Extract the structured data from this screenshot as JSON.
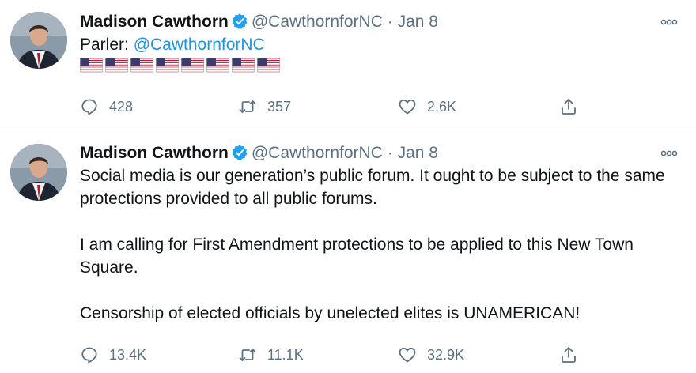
{
  "tweets": [
    {
      "author_name": "Madison Cawthorn",
      "handle": "@CawthornforNC",
      "separator": "·",
      "date": "Jan 8",
      "text_prefix": "Parler: ",
      "text_link": "@CawthornforNC",
      "flag_count_emoji": "🇺🇸🇺🇸🇺🇸🇺🇸🇺🇸🇺🇸🇺🇸🇺🇸",
      "replies": "428",
      "retweets": "357",
      "likes": "2.6K"
    },
    {
      "author_name": "Madison Cawthorn",
      "handle": "@CawthornforNC",
      "separator": "·",
      "date": "Jan 8",
      "paragraphs": [
        "Social media is our generation’s public forum. It ought to be subject to the same protections provided to all public forums.",
        "I am calling for First Amendment protections to be applied to this New Town Square.",
        "Censorship of elected officials by unelected elites is UNAMERICAN!"
      ],
      "replies": "13.4K",
      "retweets": "11.1K",
      "likes": "32.9K"
    }
  ],
  "icons": {
    "verified": "verified-badge-icon",
    "more": "more-options-icon",
    "reply": "reply-icon",
    "retweet": "retweet-icon",
    "like": "heart-icon",
    "share": "share-icon"
  },
  "colors": {
    "link": "#1b95e0",
    "secondary_text": "#5b7083",
    "verified": "#1da1f2",
    "divider": "#e6ecf0"
  }
}
